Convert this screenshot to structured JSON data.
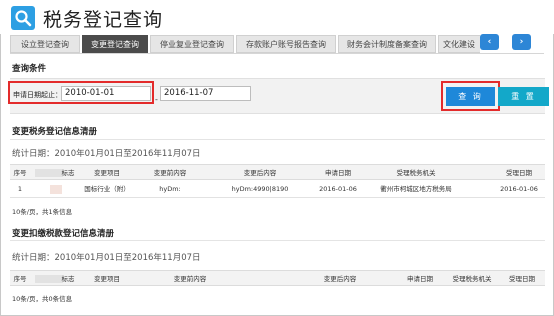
{
  "header": {
    "title": "税务登记查询",
    "logo_icon": "search-icon"
  },
  "tabs": [
    {
      "label": "设立登记查询",
      "active": false
    },
    {
      "label": "变更登记查询",
      "active": true
    },
    {
      "label": "停业复业登记查询",
      "active": false
    },
    {
      "label": "存款账户账号报告查询",
      "active": false
    },
    {
      "label": "财务会计制度备案查询",
      "active": false
    },
    {
      "label": "文化建设",
      "active": false
    }
  ],
  "nav": {
    "prev_icon": "chevron-left-icon",
    "prev_glyph": "‹",
    "next_icon": "chevron-right-icon",
    "next_glyph": "›"
  },
  "query": {
    "section_title": "查询条件",
    "date_label": "申请日期起止：",
    "date_from": "2010-01-01",
    "date_sep": "-",
    "date_to": "2016-11-07",
    "search_label": "查 询",
    "reset_label": "重 置"
  },
  "table1": {
    "title": "变更税务登记信息清册",
    "stat": "统计日期：2010年01月01日至2016年11月07日",
    "headers": [
      "序号",
      "标志",
      "变更项目",
      "变更前内容",
      "变更后内容",
      "申请日期",
      "受理税务机关",
      "受理日期"
    ],
    "rows": [
      {
        "no": "1",
        "flag": "",
        "item": "国标行业（附）",
        "before": "hyDm:",
        "after": "hyDm:4990|8190",
        "apply_date": "2016-01-06",
        "office": "衢州市柯城区地方税务局",
        "accept_date": "2016-01-06"
      }
    ],
    "pager": "10条/页，共1条信息"
  },
  "table2": {
    "title": "变更扣缴税款登记信息清册",
    "stat": "统计日期：2010年01月01日至2016年11月07日",
    "headers": [
      "序号",
      "标志",
      "变更项目",
      "变更前内容",
      "变更后内容",
      "申请日期",
      "受理税务机关",
      "受理日期"
    ],
    "pager": "10条/页，共0条信息"
  },
  "colors": {
    "accent": "#1e88d9",
    "reset": "#13a8c9",
    "highlight": "#e32b2b"
  }
}
